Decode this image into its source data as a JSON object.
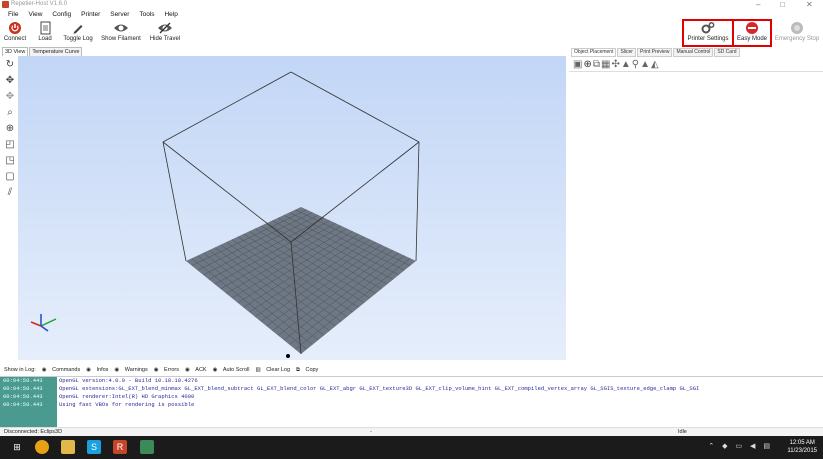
{
  "window": {
    "title": "Repetier-Host V1.6.0",
    "controls": [
      "–",
      "□",
      "✕"
    ]
  },
  "menu": [
    "File",
    "View",
    "Config",
    "Printer",
    "Server",
    "Tools",
    "Help"
  ],
  "toolbar": {
    "left": [
      {
        "label": "Connect",
        "icon": "power-icon"
      },
      {
        "label": "Load",
        "icon": "document-icon"
      },
      {
        "label": "Toggle Log",
        "icon": "pencil-icon"
      },
      {
        "label": "Show Filament",
        "icon": "eye-icon"
      },
      {
        "label": "Hide Travel",
        "icon": "eye-slash-icon"
      }
    ],
    "right": [
      {
        "label": "Printer Settings",
        "icon": "gears-icon"
      },
      {
        "label": "Easy Mode",
        "icon": "easy-mode-icon"
      },
      {
        "label": "Emergency Stop",
        "icon": "stop-icon"
      }
    ],
    "highlight_color": "#e10000"
  },
  "view_tabs": [
    "3D View",
    "Temperature Curve"
  ],
  "right_tabs": [
    "Object Placement",
    "Slicer",
    "Print Preview",
    "Manual Control",
    "SD Card"
  ],
  "log": {
    "filters": [
      "Show in Log:",
      "Commands",
      "Infos",
      "Warnings",
      "Errors",
      "ACK",
      "Auto Scroll",
      "Clear Log",
      "Copy"
    ],
    "entries": [
      {
        "time": "00:04:50.443",
        "msg": "OpenGL version:4.0.0 - Build 10.18.10.4276"
      },
      {
        "time": "00:04:50.443",
        "msg": "OpenGL extensions:GL_EXT_blend_minmax GL_EXT_blend_subtract GL_EXT_blend_color GL_EXT_abgr GL_EXT_texture3D GL_EXT_clip_volume_hint GL_EXT_compiled_vertex_array GL_SGIS_texture_edge_clamp GL_SGI"
      },
      {
        "time": "00:04:50.443",
        "msg": "OpenGL renderer:Intel(R) HD Graphics 4000"
      },
      {
        "time": "00:04:50.443",
        "msg": "Using fast VBOs for rendering is possible"
      }
    ]
  },
  "status": {
    "left": "Disconnected: Eclips3D",
    "middle": "-",
    "right": "Idle"
  },
  "taskbar": {
    "time": "12:05 AM",
    "date": "11/23/2015"
  },
  "colors": {
    "viewport_top": "#c2d6f6",
    "viewport_bottom": "#e6eefb",
    "bed": "#6e7784",
    "log_time_bg": "#4a9a90",
    "log_text": "#2a2a9a"
  }
}
